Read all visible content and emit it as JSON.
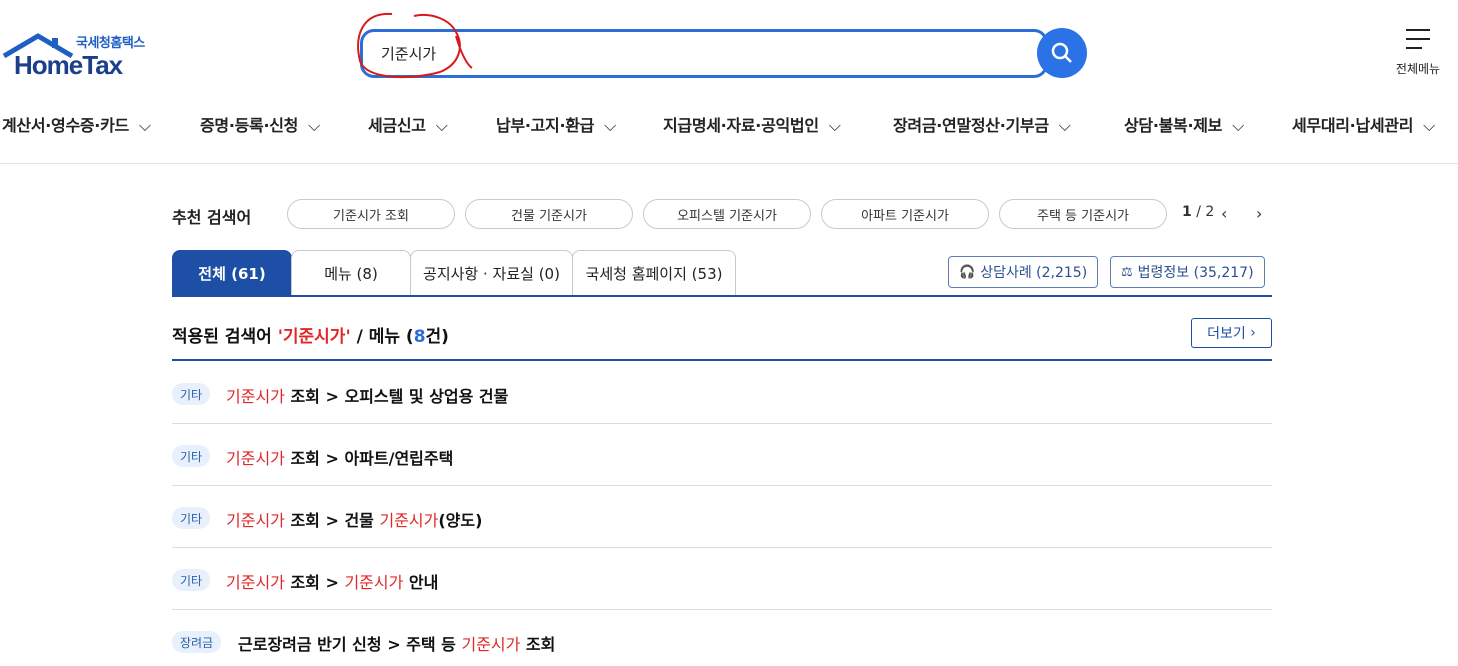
{
  "header": {
    "logo_sub": "국세청홈택스",
    "logo_main": "HomeTax",
    "search_value": "기준시가",
    "all_menu_label": "전체메뉴"
  },
  "nav": {
    "items": [
      "계산서·영수증·카드",
      "증명·등록·신청",
      "세금신고",
      "납부·고지·환급",
      "지급명세·자료·공익법인",
      "장려금·연말정산·기부금",
      "상담·불복·제보",
      "세무대리·납세관리"
    ]
  },
  "recommended": {
    "label": "추천 검색어",
    "chips": [
      "기준시가 조회",
      "건물 기준시가",
      "오피스텔 기준시가",
      "아파트 기준시가",
      "주택 등 기준시가"
    ],
    "page_current": "1",
    "page_total": "/ 2"
  },
  "tabs": [
    {
      "label": "전체 (61)"
    },
    {
      "label": "메뉴 (8)"
    },
    {
      "label": "공지사항 · 자료실 (0)"
    },
    {
      "label": "국세청 홈페이지 (53)"
    }
  ],
  "external": {
    "consult_label": "상담사례 (2,215)",
    "law_label": "법령정보 (35,217)"
  },
  "result": {
    "prefix": "적용된 검색어 ",
    "keyword": "'기준시가'",
    "middle": " / 메뉴 (",
    "count": "8",
    "suffix": "건)",
    "more_label": "더보기"
  },
  "rows": [
    {
      "badge": "기타",
      "hl1": "기준시가",
      "t1": " 조회 > 오피스텔 및 상업용 건물",
      "hl2": "",
      "t2": ""
    },
    {
      "badge": "기타",
      "hl1": "기준시가",
      "t1": " 조회 > 아파트/연립주택",
      "hl2": "",
      "t2": ""
    },
    {
      "badge": "기타",
      "hl1": "기준시가",
      "t1": " 조회 > 건물 ",
      "hl2": "기준시가",
      "t2": "(양도)"
    },
    {
      "badge": "기타",
      "hl1": "기준시가",
      "t1": " 조회 > ",
      "hl2": "기준시가",
      "t2": " 안내"
    },
    {
      "badge": "장려금",
      "hl1": "",
      "t1": "근로장려금 반기 신청 > 주택 등 ",
      "hl2": "기준시가",
      "t2": " 조회"
    }
  ],
  "colors": {
    "primary": "#1d4fa6",
    "search_border": "#2b6fd6",
    "highlight": "#e02828"
  }
}
